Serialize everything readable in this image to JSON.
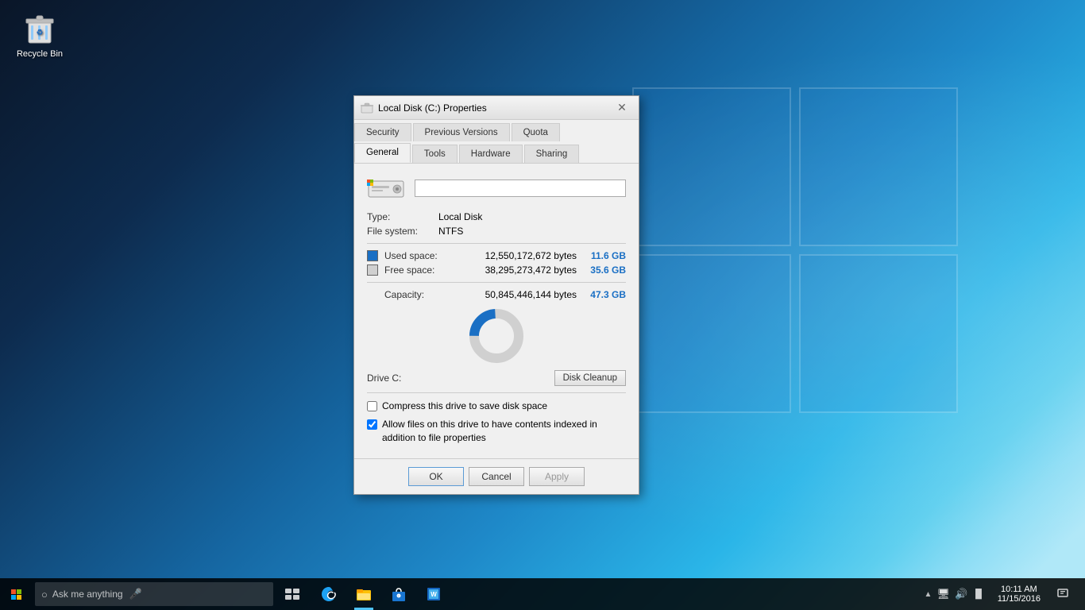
{
  "desktop": {
    "recycle_bin_label": "Recycle Bin"
  },
  "dialog": {
    "title": "Local Disk (C:) Properties",
    "tabs_row1": [
      {
        "label": "Security",
        "active": false
      },
      {
        "label": "Previous Versions",
        "active": false
      },
      {
        "label": "Quota",
        "active": false
      }
    ],
    "tabs_row2": [
      {
        "label": "General",
        "active": true
      },
      {
        "label": "Tools",
        "active": false
      },
      {
        "label": "Hardware",
        "active": false
      },
      {
        "label": "Sharing",
        "active": false
      }
    ],
    "disk_name_placeholder": "",
    "type_label": "Type:",
    "type_value": "Local Disk",
    "filesystem_label": "File system:",
    "filesystem_value": "NTFS",
    "used_space_label": "Used space:",
    "used_space_bytes": "12,550,172,672 bytes",
    "used_space_human": "11.6 GB",
    "free_space_label": "Free space:",
    "free_space_bytes": "38,295,273,472 bytes",
    "free_space_human": "35.6 GB",
    "capacity_label": "Capacity:",
    "capacity_bytes": "50,845,446,144 bytes",
    "capacity_human": "47.3 GB",
    "drive_label": "Drive C:",
    "disk_cleanup_label": "Disk Cleanup",
    "compress_label": "Compress this drive to save disk space",
    "index_label": "Allow files on this drive to have contents indexed in addition to file properties",
    "ok_label": "OK",
    "cancel_label": "Cancel",
    "apply_label": "Apply",
    "used_pct": 24,
    "free_pct": 76
  },
  "taskbar": {
    "search_placeholder": "Ask me anything",
    "time": "10:11 AM",
    "date": "11/15/2016"
  }
}
